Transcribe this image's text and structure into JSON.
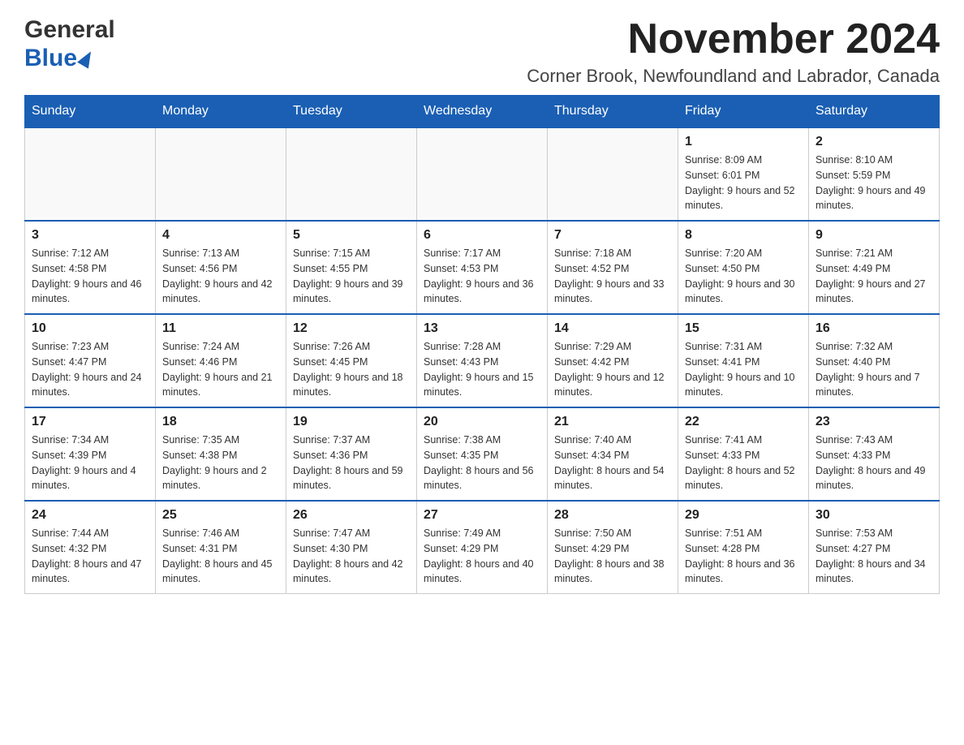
{
  "header": {
    "logo_general": "General",
    "logo_blue": "Blue",
    "month_title": "November 2024",
    "location": "Corner Brook, Newfoundland and Labrador, Canada"
  },
  "weekdays": [
    "Sunday",
    "Monday",
    "Tuesday",
    "Wednesday",
    "Thursday",
    "Friday",
    "Saturday"
  ],
  "weeks": [
    [
      {
        "day": "",
        "info": ""
      },
      {
        "day": "",
        "info": ""
      },
      {
        "day": "",
        "info": ""
      },
      {
        "day": "",
        "info": ""
      },
      {
        "day": "",
        "info": ""
      },
      {
        "day": "1",
        "info": "Sunrise: 8:09 AM\nSunset: 6:01 PM\nDaylight: 9 hours and 52 minutes."
      },
      {
        "day": "2",
        "info": "Sunrise: 8:10 AM\nSunset: 5:59 PM\nDaylight: 9 hours and 49 minutes."
      }
    ],
    [
      {
        "day": "3",
        "info": "Sunrise: 7:12 AM\nSunset: 4:58 PM\nDaylight: 9 hours and 46 minutes."
      },
      {
        "day": "4",
        "info": "Sunrise: 7:13 AM\nSunset: 4:56 PM\nDaylight: 9 hours and 42 minutes."
      },
      {
        "day": "5",
        "info": "Sunrise: 7:15 AM\nSunset: 4:55 PM\nDaylight: 9 hours and 39 minutes."
      },
      {
        "day": "6",
        "info": "Sunrise: 7:17 AM\nSunset: 4:53 PM\nDaylight: 9 hours and 36 minutes."
      },
      {
        "day": "7",
        "info": "Sunrise: 7:18 AM\nSunset: 4:52 PM\nDaylight: 9 hours and 33 minutes."
      },
      {
        "day": "8",
        "info": "Sunrise: 7:20 AM\nSunset: 4:50 PM\nDaylight: 9 hours and 30 minutes."
      },
      {
        "day": "9",
        "info": "Sunrise: 7:21 AM\nSunset: 4:49 PM\nDaylight: 9 hours and 27 minutes."
      }
    ],
    [
      {
        "day": "10",
        "info": "Sunrise: 7:23 AM\nSunset: 4:47 PM\nDaylight: 9 hours and 24 minutes."
      },
      {
        "day": "11",
        "info": "Sunrise: 7:24 AM\nSunset: 4:46 PM\nDaylight: 9 hours and 21 minutes."
      },
      {
        "day": "12",
        "info": "Sunrise: 7:26 AM\nSunset: 4:45 PM\nDaylight: 9 hours and 18 minutes."
      },
      {
        "day": "13",
        "info": "Sunrise: 7:28 AM\nSunset: 4:43 PM\nDaylight: 9 hours and 15 minutes."
      },
      {
        "day": "14",
        "info": "Sunrise: 7:29 AM\nSunset: 4:42 PM\nDaylight: 9 hours and 12 minutes."
      },
      {
        "day": "15",
        "info": "Sunrise: 7:31 AM\nSunset: 4:41 PM\nDaylight: 9 hours and 10 minutes."
      },
      {
        "day": "16",
        "info": "Sunrise: 7:32 AM\nSunset: 4:40 PM\nDaylight: 9 hours and 7 minutes."
      }
    ],
    [
      {
        "day": "17",
        "info": "Sunrise: 7:34 AM\nSunset: 4:39 PM\nDaylight: 9 hours and 4 minutes."
      },
      {
        "day": "18",
        "info": "Sunrise: 7:35 AM\nSunset: 4:38 PM\nDaylight: 9 hours and 2 minutes."
      },
      {
        "day": "19",
        "info": "Sunrise: 7:37 AM\nSunset: 4:36 PM\nDaylight: 8 hours and 59 minutes."
      },
      {
        "day": "20",
        "info": "Sunrise: 7:38 AM\nSunset: 4:35 PM\nDaylight: 8 hours and 56 minutes."
      },
      {
        "day": "21",
        "info": "Sunrise: 7:40 AM\nSunset: 4:34 PM\nDaylight: 8 hours and 54 minutes."
      },
      {
        "day": "22",
        "info": "Sunrise: 7:41 AM\nSunset: 4:33 PM\nDaylight: 8 hours and 52 minutes."
      },
      {
        "day": "23",
        "info": "Sunrise: 7:43 AM\nSunset: 4:33 PM\nDaylight: 8 hours and 49 minutes."
      }
    ],
    [
      {
        "day": "24",
        "info": "Sunrise: 7:44 AM\nSunset: 4:32 PM\nDaylight: 8 hours and 47 minutes."
      },
      {
        "day": "25",
        "info": "Sunrise: 7:46 AM\nSunset: 4:31 PM\nDaylight: 8 hours and 45 minutes."
      },
      {
        "day": "26",
        "info": "Sunrise: 7:47 AM\nSunset: 4:30 PM\nDaylight: 8 hours and 42 minutes."
      },
      {
        "day": "27",
        "info": "Sunrise: 7:49 AM\nSunset: 4:29 PM\nDaylight: 8 hours and 40 minutes."
      },
      {
        "day": "28",
        "info": "Sunrise: 7:50 AM\nSunset: 4:29 PM\nDaylight: 8 hours and 38 minutes."
      },
      {
        "day": "29",
        "info": "Sunrise: 7:51 AM\nSunset: 4:28 PM\nDaylight: 8 hours and 36 minutes."
      },
      {
        "day": "30",
        "info": "Sunrise: 7:53 AM\nSunset: 4:27 PM\nDaylight: 8 hours and 34 minutes."
      }
    ]
  ]
}
